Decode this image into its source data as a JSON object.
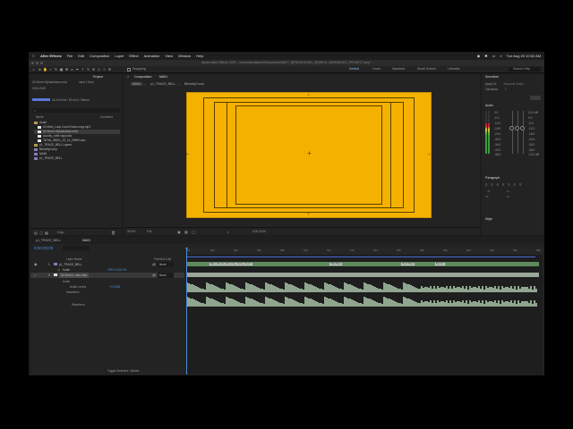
{
  "menubar": {
    "apple": "",
    "app_name": "After Effects",
    "items": [
      "File",
      "Edit",
      "Composition",
      "Layer",
      "Effect",
      "Animation",
      "View",
      "Window",
      "Help"
    ],
    "clock": "Tue Aug 20  10:52 AM"
  },
  "window": {
    "title": "Adobe After Effects 2020 - /Users/bendtalent/Documents/MATT_BENDS/VIDEO_SEARCH_0819/WIDEO_PROJECT.aep *"
  },
  "workspaces": {
    "items": [
      "Default",
      "Learn",
      "Standard",
      "Small Screen",
      "Libraries"
    ],
    "active": "Default"
  },
  "search": {
    "placeholder": "Search Help"
  },
  "project": {
    "tab": "Project",
    "selected_name": "04 Seven Splashdown.m4a",
    "selected_info": "used 1 time",
    "duration": "0:00:43:09",
    "format": "44.100 kHz / 32 bit U / Stereo",
    "search_placeholder": "",
    "col_name": "Name",
    "col_comment": "Comment",
    "files": [
      {
        "name": "Audio",
        "type": "folder"
      },
      {
        "name": "04 Main_Loop Count Down copy.mp3",
        "type": "audio"
      },
      {
        "name": "04 Seven Splashdown.m4a",
        "type": "audio",
        "selected": true
      },
      {
        "name": "scooby_ruhe copy.wav",
        "type": "audio"
      },
      {
        "name": "TikTok_28931_19_12_29590.wav",
        "type": "audio"
      },
      {
        "name": "p1_TRACE_BELL Layers",
        "type": "folder"
      },
      {
        "name": "BlendifyComp",
        "type": "comp"
      },
      {
        "name": "MAIN",
        "type": "comp"
      },
      {
        "name": "p1_TRACE_BELL",
        "type": "comp"
      }
    ],
    "bpc": "8 bpc"
  },
  "composition": {
    "tab": "Composition",
    "comp_name": "MAIN",
    "breadcrumbs": [
      "MAIN",
      "p1_TRACE_BELL",
      "BlendifyComp"
    ],
    "zoom": "33.3%",
    "resolution": "Full",
    "timecode": "0;00;00;00"
  },
  "right_panel": {
    "smoother": "Smoother",
    "apply_to": "Apply To:",
    "apply_value": "Temporal Graph",
    "tolerance": "Tolerance:",
    "tolerance_value": "1",
    "audio": "Audio",
    "db_scale": [
      "0.0",
      "-6.0",
      "-12.0",
      "-18.0",
      "-24.0",
      "-30.0",
      "-36.0",
      "-42.0",
      "-48.0"
    ],
    "db_right": [
      "12.0 dB",
      "0.0",
      "-6.0",
      "-12.0",
      "-18.0",
      "-24.0",
      "-30.0",
      "-36.0",
      "-12.0 dB"
    ],
    "paragraph": "Paragraph",
    "align": "Align"
  },
  "timeline": {
    "tabs": [
      "p1_TRACE_BELL",
      "MAIN"
    ],
    "active_tab": "MAIN",
    "timecode": "0;00;00;00",
    "col_layer": "Layer Name",
    "col_parent": "Parent & Link",
    "layers": [
      {
        "num": "1",
        "name": "p1_TRACE_BELL",
        "parent": "None"
      },
      {
        "name": "Scale",
        "value": "2390.5,318.3%"
      },
      {
        "num": "2",
        "name": "04 Seven...own.m4a",
        "parent": "None",
        "selected": true
      }
    ],
    "audio_label": "Audio",
    "audio_levels": "Audio Levels",
    "audio_levels_value": "+0.00dB",
    "waveform_label": "Waveform",
    "waveform_sub": "Waveform",
    "toggle": "Toggle Switches / Modes",
    "ruler": [
      "0s",
      "02s",
      "04s",
      "06s",
      "08s",
      "10s",
      "12s",
      "14s",
      "16s",
      "18s",
      "20s",
      "22s",
      "24s",
      "26s",
      "28s",
      "30s"
    ],
    "markers": [
      "Bass_Bounce_Bouncing_Flying_Sound",
      "Slide Bass",
      "Down Bass",
      "Bounce"
    ]
  }
}
